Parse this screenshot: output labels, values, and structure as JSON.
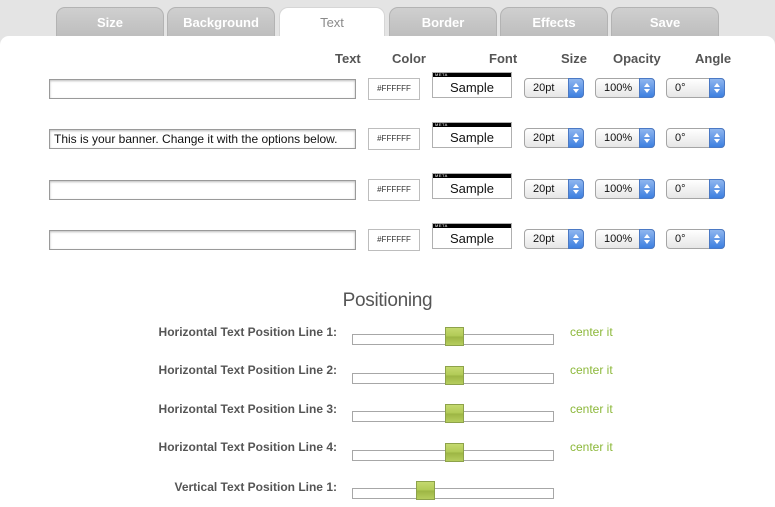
{
  "tabs": [
    {
      "label": "Size",
      "active": false
    },
    {
      "label": "Background",
      "active": false
    },
    {
      "label": "Text",
      "active": true
    },
    {
      "label": "Border",
      "active": false
    },
    {
      "label": "Effects",
      "active": false
    },
    {
      "label": "Save",
      "active": false
    }
  ],
  "headers": {
    "text": "Text",
    "color": "Color",
    "font": "Font",
    "size": "Size",
    "opacity": "Opacity",
    "angle": "Angle"
  },
  "lines": [
    {
      "text": "",
      "color": "#FFFFFF",
      "font_meta": "META",
      "font_sample": "Sample",
      "size": "20pt",
      "opacity": "100%",
      "angle": "0°"
    },
    {
      "text": "This is your banner. Change it with the options below.",
      "color": "#FFFFFF",
      "font_meta": "META",
      "font_sample": "Sample",
      "size": "20pt",
      "opacity": "100%",
      "angle": "0°"
    },
    {
      "text": "",
      "color": "#FFFFFF",
      "font_meta": "META",
      "font_sample": "Sample",
      "size": "20pt",
      "opacity": "100%",
      "angle": "0°"
    },
    {
      "text": "",
      "color": "#FFFFFF",
      "font_meta": "META",
      "font_sample": "Sample",
      "size": "20pt",
      "opacity": "100%",
      "angle": "0°"
    }
  ],
  "positioning": {
    "title": "Positioning",
    "sliders": [
      {
        "label": "Horizontal Text Position Line 1:",
        "value": 0.5,
        "action": "center it"
      },
      {
        "label": "Horizontal Text Position Line 2:",
        "value": 0.5,
        "action": "center it"
      },
      {
        "label": "Horizontal Text Position Line 3:",
        "value": 0.5,
        "action": "center it"
      },
      {
        "label": "Horizontal Text Position Line 4:",
        "value": 0.5,
        "action": "center it"
      },
      {
        "label": "Vertical Text Position Line 1:",
        "value": 0.36,
        "action": ""
      }
    ]
  },
  "colors": {
    "accent_green": "#8cb83a",
    "slider_knob": "#b0c955",
    "select_arrow": "#3d7fe0"
  }
}
